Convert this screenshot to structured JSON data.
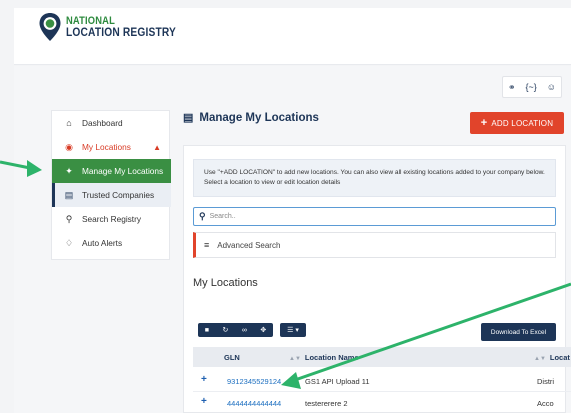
{
  "brand": {
    "line1": "NATIONAL",
    "line2": "LOCATION REGISTRY"
  },
  "header": {
    "icons": [
      "headset-icon",
      "code-icon",
      "user-icon"
    ]
  },
  "sidebar": {
    "items": [
      {
        "label": "Dashboard",
        "icon": "home-icon"
      },
      {
        "label": "My Locations",
        "icon": "location-icon"
      },
      {
        "label": "Manage My Locations",
        "icon": "manage-icon"
      },
      {
        "label": "Trusted Companies",
        "icon": "building-icon"
      },
      {
        "label": "Search Registry",
        "icon": "search-icon"
      },
      {
        "label": "Auto Alerts",
        "icon": "bell-icon"
      }
    ]
  },
  "main": {
    "title": "Manage My Locations",
    "add_button": "ADD LOCATION",
    "info": "Use \"+ADD LOCATION\" to add new locations. You can also view all existing locations added to your company below. Select a location to view or edit location details",
    "search_placeholder": "Search..",
    "advanced_search": "Advanced Search",
    "section_title": "My Locations",
    "download_button": "Download To Excel",
    "table": {
      "headers": [
        "GLN",
        "Location Name",
        "Locat"
      ],
      "rows": [
        {
          "gln": "9312345529124",
          "name": "GS1 API Upload 11",
          "loc": "Distri"
        },
        {
          "gln": "4444444444444",
          "name": "testererere 2",
          "loc": "Acco"
        }
      ]
    }
  },
  "colors": {
    "brand_green": "#3a8f43",
    "brand_navy": "#1d3557",
    "accent_red": "#e1442b",
    "annotation_arrow": "#2db36a"
  }
}
